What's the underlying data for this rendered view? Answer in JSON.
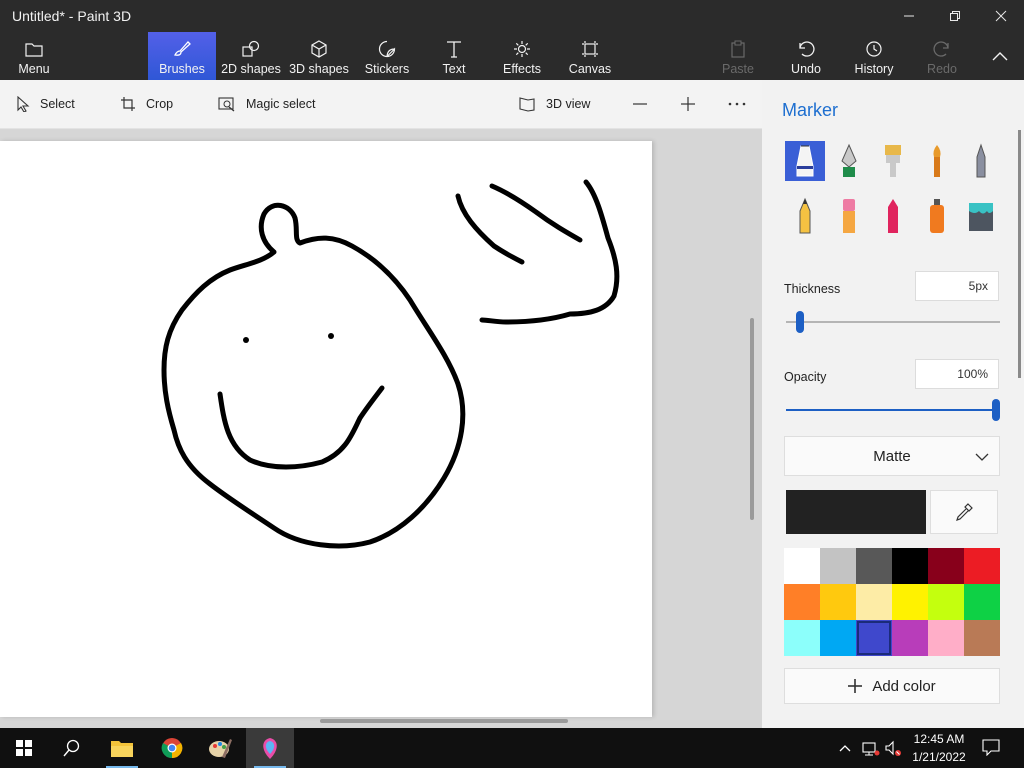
{
  "window": {
    "title": "Untitled* - Paint 3D"
  },
  "ribbon": {
    "menu": "Menu",
    "tools": [
      "Brushes",
      "2D shapes",
      "3D shapes",
      "Stickers",
      "Text",
      "Effects",
      "Canvas"
    ],
    "active_tool": "Brushes",
    "actions": [
      "Paste",
      "Undo",
      "History",
      "Redo"
    ]
  },
  "subtoolbar": {
    "select": "Select",
    "crop": "Crop",
    "magic_select": "Magic select",
    "view_3d": "3D view"
  },
  "panel": {
    "title": "Marker",
    "thickness_label": "Thickness",
    "thickness_value": "5px",
    "thickness_fraction": 0.05,
    "opacity_label": "Opacity",
    "opacity_value": "100%",
    "opacity_fraction": 1.0,
    "finish": "Matte",
    "current_color": "#222222",
    "add_color": "Add color",
    "palette": [
      "#ffffff",
      "#c3c3c3",
      "#585858",
      "#000000",
      "#88001b",
      "#ec1c24",
      "#ff7f27",
      "#ffc90e",
      "#fdeca6",
      "#fff200",
      "#c4ff0e",
      "#0ed145",
      "#8cfffb",
      "#00a8f3",
      "#3f48cc",
      "#b83dba",
      "#ffaec8",
      "#b97a56"
    ],
    "selected_swatch_index": 14,
    "brushes": [
      "marker",
      "calligraphy-pen",
      "oil-brush",
      "watercolor",
      "pixel-pen",
      "pencil",
      "eraser",
      "crayon",
      "spray-can",
      "fill"
    ]
  },
  "taskbar": {
    "time": "12:45 AM",
    "date": "1/21/2022"
  }
}
